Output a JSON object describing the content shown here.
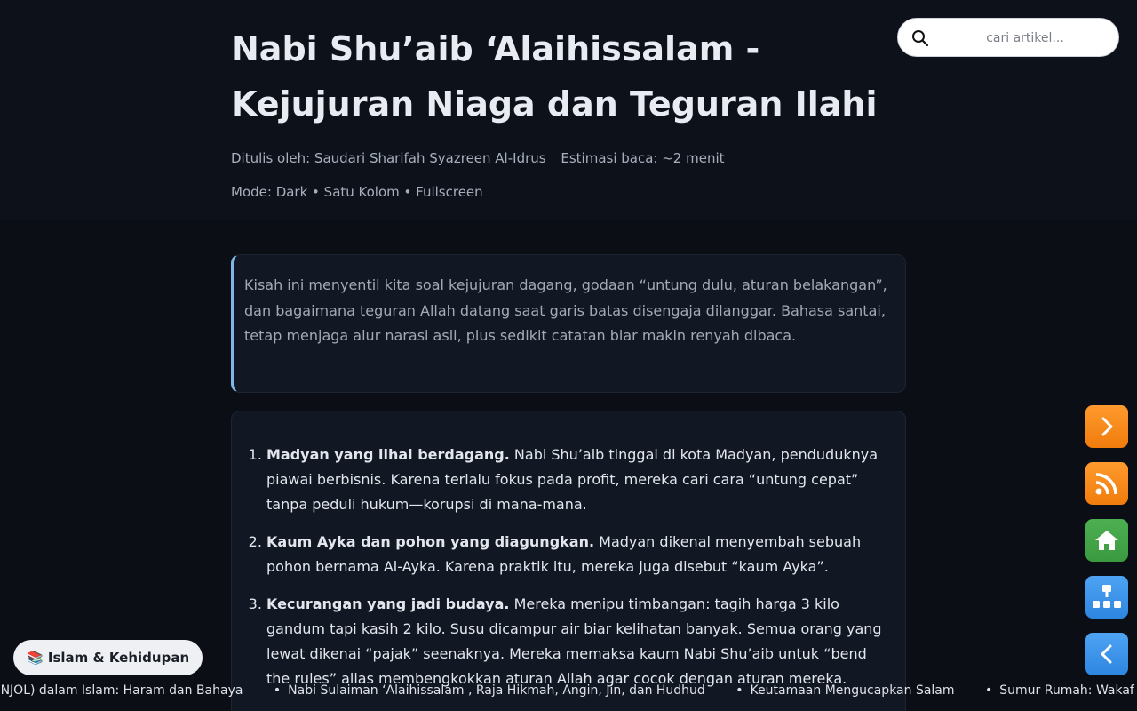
{
  "article": {
    "title": "Nabi Shu’aib ‘Alaihissalam - Kejujuran Niaga dan Teguran Ilahi",
    "author": "Ditulis oleh: Saudari Sharifah Syazreen Al-Idrus",
    "read_time": "Estimasi baca: ~2 menit",
    "mode": "Mode: Dark • Satu Kolom • Fullscreen",
    "intro": "Kisah ini menyentil kita soal kejujuran dagang, godaan “untung dulu, aturan belakangan”, dan bagaimana teguran Allah datang saat garis batas disengaja dilanggar. Bahasa santai, tetap menjaga alur narasi asli, plus sedikit catatan biar makin renyah dibaca.",
    "points": [
      {
        "heading": "Madyan yang lihai berdagang.",
        "text": "Nabi Shu’aib tinggal di kota Madyan, penduduknya piawai berbisnis. Karena terlalu fokus pada profit, mereka cari cara “untung cepat” tanpa peduli hukum—korupsi di mana-mana."
      },
      {
        "heading": "Kaum Ayka dan pohon yang diagungkan.",
        "text": "Madyan dikenal menyembah sebuah pohon bernama Al-Ayka. Karena praktik itu, mereka juga disebut “kaum Ayka”."
      },
      {
        "heading": "Kecurangan yang jadi budaya.",
        "text": "Mereka menipu timbangan: tagih harga 3 kilo gandum tapi kasih 2 kilo. Susu dicampur air biar kelihatan banyak. Semua orang yang lewat dikenai “pajak” seenaknya. Mereka memaksa kaum Nabi Shu’aib untuk “bend the rules” alias membengkokkan aturan Allah agar cocok dengan aturan mereka."
      }
    ]
  },
  "search": {
    "placeholder": "cari artikel..."
  },
  "category": {
    "label": "📚 Islam & Kehidupan"
  },
  "ticker": {
    "items": [
      "PINJOL) dalam Islam: Haram dan Bahaya",
      "Nabi Sulaiman ‘Alaihissalam , Raja Hikmah, Angin, Jin, dan Hudhud",
      "Keutamaan Mengucapkan Salam",
      "Sumur Rumah: Wakaf Utsman"
    ]
  },
  "nav": {
    "icons": [
      "chevron-right-icon",
      "rss-icon",
      "home-icon",
      "sitemap-icon",
      "chevron-left-icon"
    ]
  },
  "colors": {
    "background": "#0b0e14",
    "header": "#0d111a",
    "card": "#111723",
    "intro_accent": "#7fb8e6",
    "orange": "#f7890f",
    "green": "#43a047",
    "blue": "#3b93ea"
  }
}
